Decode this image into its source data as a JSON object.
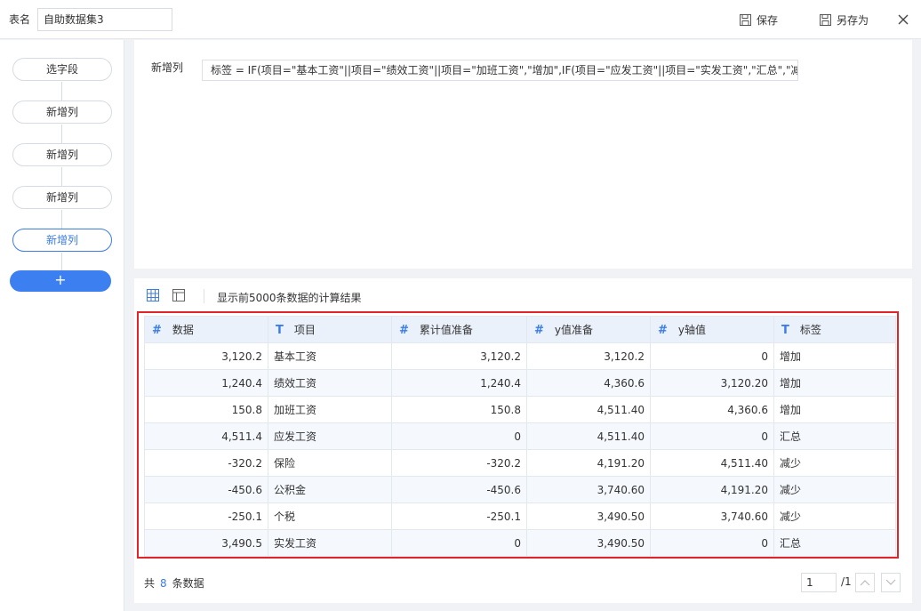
{
  "header": {
    "table_name_label": "表名",
    "table_name_value": "自助数据集3",
    "save_label": "保存",
    "save_as_label": "另存为"
  },
  "steps": {
    "items": [
      {
        "label": "选字段"
      },
      {
        "label": "新增列"
      },
      {
        "label": "新增列"
      },
      {
        "label": "新增列"
      },
      {
        "label": "新增列",
        "active": true
      }
    ],
    "add_label": "+"
  },
  "formula": {
    "label": "新增列",
    "text": "标签 = IF(项目=\"基本工资\"||项目=\"绩效工资\"||项目=\"加班工资\",\"增加\",IF(项目=\"应发工资\"||项目=\"实发工资\",\"汇总\",\"减少\"))"
  },
  "result": {
    "note": "显示前5000条数据的计算结果",
    "columns": [
      {
        "type": "#",
        "name": "数据"
      },
      {
        "type": "T",
        "name": "项目"
      },
      {
        "type": "#",
        "name": "累计值准备"
      },
      {
        "type": "#",
        "name": "y值准备"
      },
      {
        "type": "#",
        "name": "y轴值"
      },
      {
        "type": "T",
        "name": "标签"
      }
    ],
    "rows": [
      [
        "3,120.2",
        "基本工资",
        "3,120.2",
        "3,120.2",
        "0",
        "增加"
      ],
      [
        "1,240.4",
        "绩效工资",
        "1,240.4",
        "4,360.6",
        "3,120.20",
        "增加"
      ],
      [
        "150.8",
        "加班工资",
        "150.8",
        "4,511.40",
        "4,360.6",
        "增加"
      ],
      [
        "4,511.4",
        "应发工资",
        "0",
        "4,511.40",
        "0",
        "汇总"
      ],
      [
        "-320.2",
        "保险",
        "-320.2",
        "4,191.20",
        "4,511.40",
        "减少"
      ],
      [
        "-450.6",
        "公积金",
        "-450.6",
        "3,740.60",
        "4,191.20",
        "减少"
      ],
      [
        "-250.1",
        "个税",
        "-250.1",
        "3,490.50",
        "3,740.60",
        "减少"
      ],
      [
        "3,490.5",
        "实发工资",
        "0",
        "3,490.50",
        "0",
        "汇总"
      ]
    ],
    "footer": {
      "prefix": "共",
      "count": "8",
      "suffix": "条数据"
    },
    "pager": {
      "page": "1",
      "total": "/1"
    }
  },
  "colors": {
    "accent": "#3a7ce9",
    "highlight": "#e0242a"
  }
}
